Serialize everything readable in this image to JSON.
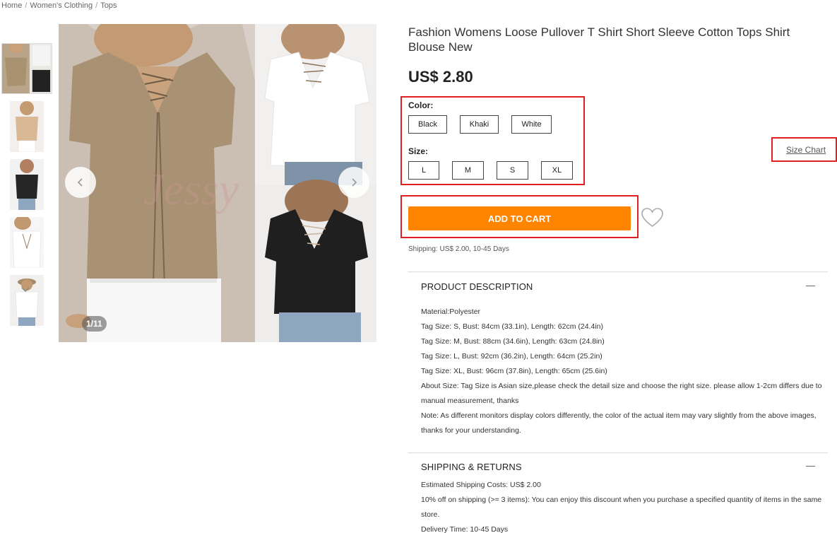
{
  "breadcrumb": [
    "Home",
    "Women's Clothing",
    "Tops"
  ],
  "product": {
    "title": "Fashion Womens Loose Pullover T Shirt Short Sleeve Cotton Tops Shirt Blouse New",
    "price": "US$ 2.80",
    "image_counter": "1/11"
  },
  "options": {
    "color_label": "Color:",
    "colors": [
      "Black",
      "Khaki",
      "White"
    ],
    "size_label": "Size:",
    "sizes": [
      "L",
      "M",
      "S",
      "XL"
    ],
    "size_chart": "Size Chart"
  },
  "cart": {
    "add_label": "ADD TO CART",
    "shipping": "Shipping: US$ 2.00, 10-45 Days"
  },
  "description": {
    "title": "PRODUCT DESCRIPTION",
    "lines": [
      "Material:Polyester",
      "Tag Size: S, Bust: 84cm (33.1in), Length: 62cm (24.4in)",
      "Tag Size: M, Bust: 88cm (34.6in), Length: 63cm (24.8in)",
      "Tag Size: L, Bust: 92cm (36.2in), Length: 64cm (25.2in)",
      "Tag Size: XL, Bust: 96cm (37.8in), Length: 65cm (25.6in)",
      "About Size: Tag Size is Asian size,please check the detail size and choose the right size. please allow 1-2cm differs due to manual measurement, thanks",
      "Note: As different monitors display colors differently, the color of the actual item may vary slightly from the above images, thanks for your understanding."
    ]
  },
  "shipping_returns": {
    "title": "SHIPPING & RETURNS",
    "lines": [
      "Estimated Shipping Costs: US$ 2.00",
      "10% off on shipping (>= 3 items): You can enjoy this discount when you purchase a specified quantity of items in the same store.",
      "Delivery Time: 10-45 Days"
    ]
  },
  "colors": {
    "accent": "#ff8400",
    "highlight": "#e02020"
  },
  "icons": {
    "prev": "chevron-left-icon",
    "next": "chevron-right-icon",
    "thumbs_down": "chevron-down-icon",
    "wishlist": "heart-icon",
    "collapse": "minus-icon"
  }
}
